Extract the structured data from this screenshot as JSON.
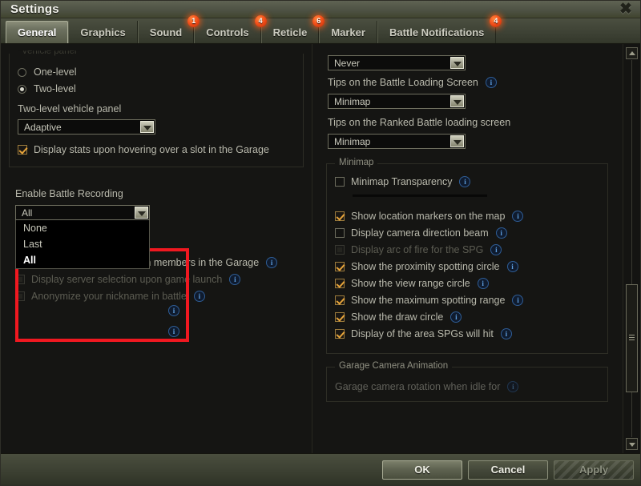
{
  "window": {
    "title": "Settings",
    "close_icon": "close-icon"
  },
  "tabs": [
    {
      "label": "General",
      "active": true,
      "badge": null
    },
    {
      "label": "Graphics",
      "active": false,
      "badge": null
    },
    {
      "label": "Sound",
      "active": false,
      "badge": "1"
    },
    {
      "label": "Controls",
      "active": false,
      "badge": "4"
    },
    {
      "label": "Reticle",
      "active": false,
      "badge": "6"
    },
    {
      "label": "Marker",
      "active": false,
      "badge": null
    },
    {
      "label": "Battle Notifications",
      "active": false,
      "badge": "4"
    }
  ],
  "left_panel": {
    "vehicle_panel_group": {
      "label": "Vehicle panel",
      "radios": [
        {
          "label": "One-level",
          "checked": false
        },
        {
          "label": "Two-level",
          "checked": true
        }
      ],
      "two_level_label": "Two-level vehicle panel",
      "two_level_value": "Adaptive",
      "stats_checkbox": {
        "label": "Display stats upon hovering over a slot in the Garage",
        "checked": true
      }
    },
    "battle_recording": {
      "label": "Enable Battle Recording",
      "value": "All",
      "options": [
        {
          "label": "None",
          "selected": false
        },
        {
          "label": "Last",
          "selected": false
        },
        {
          "label": "All",
          "selected": true
        }
      ]
    },
    "checkboxes": [
      {
        "label": "Display vehicles of Platoon members in the Garage",
        "checked": true,
        "disabled": false,
        "info": true
      },
      {
        "label": "Display server selection upon game launch",
        "checked": false,
        "disabled": true,
        "info": true
      },
      {
        "label": "Anonymize your nickname in battle",
        "checked": false,
        "disabled": true,
        "info": true
      }
    ]
  },
  "right_panel": {
    "top_combo_value": "Never",
    "tips_battle_loading": {
      "label": "Tips on the Battle Loading Screen",
      "value": "Minimap",
      "info": true
    },
    "tips_ranked_loading": {
      "label": "Tips on the Ranked Battle loading screen",
      "value": "Minimap",
      "info": false
    },
    "minimap_group": {
      "label": "Minimap",
      "transparency": {
        "label": "Minimap Transparency",
        "checked": false,
        "info": true
      },
      "checkboxes": [
        {
          "label": "Show location markers on the map",
          "checked": true,
          "disabled": false,
          "info": true
        },
        {
          "label": "Display camera direction beam",
          "checked": false,
          "disabled": false,
          "info": true
        },
        {
          "label": "Display arc of fire for the SPG",
          "checked": false,
          "disabled": true,
          "info": true
        },
        {
          "label": "Show the proximity spotting circle",
          "checked": true,
          "disabled": false,
          "info": true
        },
        {
          "label": "Show the view range circle",
          "checked": true,
          "disabled": false,
          "info": true
        },
        {
          "label": "Show the maximum spotting range",
          "checked": true,
          "disabled": false,
          "info": true
        },
        {
          "label": "Show the draw circle",
          "checked": true,
          "disabled": false,
          "info": true
        },
        {
          "label": "Display of the area SPGs will hit",
          "checked": true,
          "disabled": false,
          "info": true
        }
      ]
    },
    "garage_camera_group": {
      "label": "Garage Camera Animation",
      "rotation_label": "Garage camera rotation when idle for",
      "info": true
    }
  },
  "scrollbar": {
    "up_icon": "chevron-up-icon",
    "down_icon": "chevron-down-icon"
  },
  "footer": {
    "ok": "OK",
    "cancel": "Cancel",
    "apply": "Apply"
  },
  "colors": {
    "highlight": "#f01820",
    "badge": "#f4501a",
    "accent_check": "#e5a33a",
    "info_blue": "#5e9ede"
  }
}
